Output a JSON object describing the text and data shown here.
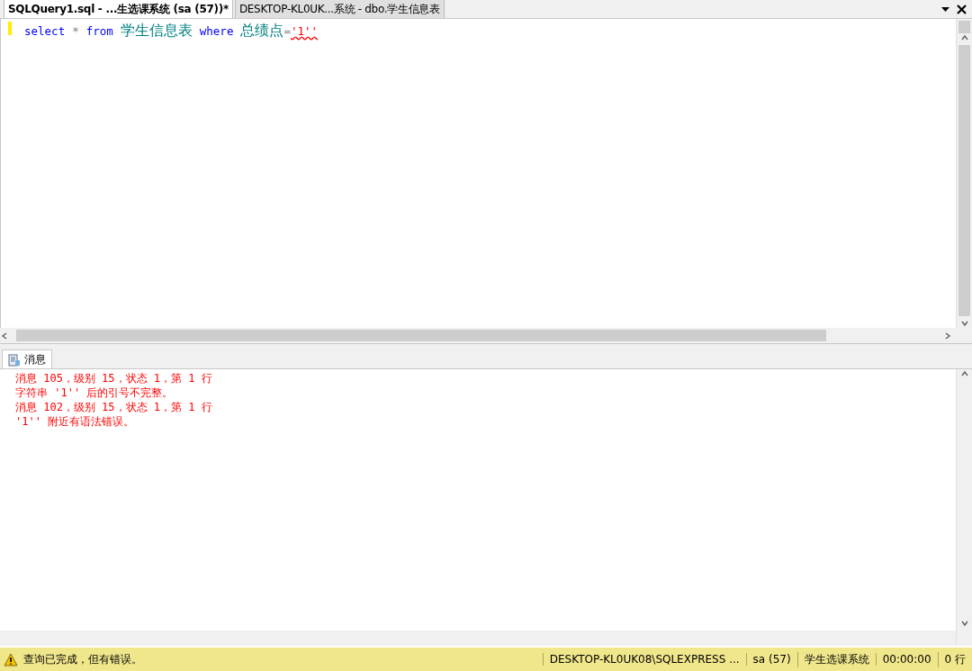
{
  "tabs": [
    {
      "label": "SQLQuery1.sql - ...生选课系统 (sa (57))*",
      "selected": true
    },
    {
      "label": "DESKTOP-KL0UK...系统 - dbo.学生信息表",
      "selected": false
    }
  ],
  "editor": {
    "words": [
      [
        {
          "text": "select",
          "kind": "keyword"
        }
      ],
      [
        {
          "text": "*",
          "kind": "operator"
        }
      ],
      [
        {
          "text": "from",
          "kind": "keyword"
        }
      ],
      [
        {
          "text": "学生信息表",
          "kind": "identifier"
        }
      ],
      [
        {
          "text": "where",
          "kind": "keyword"
        }
      ],
      [
        {
          "text": "总绩点",
          "kind": "identifier"
        },
        {
          "text": "=",
          "kind": "operator"
        },
        {
          "text": "'1''",
          "kind": "error"
        }
      ]
    ]
  },
  "results": {
    "tab": {
      "label": "消息",
      "selected": true
    },
    "messages": [
      "消息 105，级别 15，状态 1，第 1 行",
      "字符串 '1'' 后的引号不完整。",
      "消息 102，级别 15，状态 1，第 1 行",
      "'1'' 附近有语法错误。"
    ]
  },
  "status_bar": {
    "message": "查询已完成，但有错误。",
    "fields": [
      "DESKTOP-KL0UK08\\SQLEXPRESS ...",
      "sa (57)",
      "学生选课系统",
      "00:00:00",
      "0 行"
    ]
  }
}
